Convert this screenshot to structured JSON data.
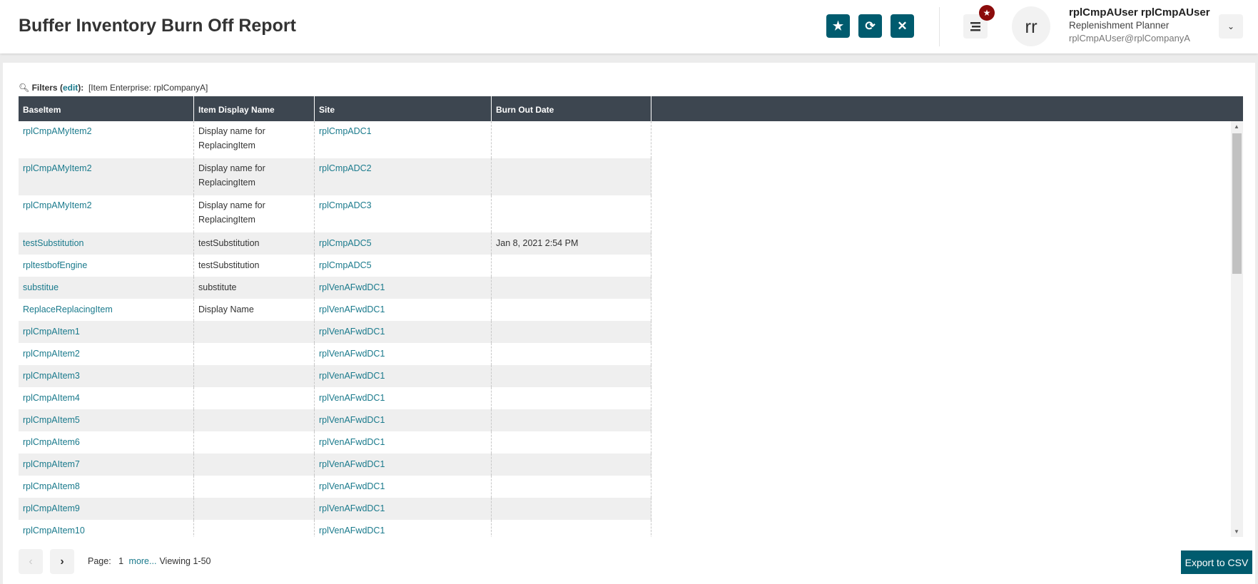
{
  "header": {
    "title": "Buffer Inventory Burn Off Report",
    "badge_icon": "star",
    "user_initials": "rr",
    "user_name": "rplCmpAUser rplCmpAUser",
    "user_role": "Replenishment Planner",
    "user_email": "rplCmpAUser@rplCompanyA"
  },
  "filters": {
    "label": "Filters",
    "edit": "edit",
    "value": "[Item Enterprise: rplCompanyA]"
  },
  "table": {
    "columns": [
      "BaseItem",
      "Item Display Name",
      "Site",
      "Burn Out Date",
      ""
    ],
    "rows": [
      [
        "rplCmpAMyItem2",
        "Display name for ReplacingItem",
        "rplCmpADC1",
        ""
      ],
      [
        "rplCmpAMyItem2",
        "Display name for ReplacingItem",
        "rplCmpADC2",
        ""
      ],
      [
        "rplCmpAMyItem2",
        "Display name for ReplacingItem",
        "rplCmpADC3",
        ""
      ],
      [
        "testSubstitution",
        "testSubstitution",
        "rplCmpADC5",
        "Jan 8, 2021 2:54 PM"
      ],
      [
        "rpltestbofEngine",
        "testSubstitution",
        "rplCmpADC5",
        ""
      ],
      [
        "substitue",
        "substitute",
        "rplVenAFwdDC1",
        ""
      ],
      [
        "ReplaceReplacingItem",
        "Display Name",
        "rplVenAFwdDC1",
        ""
      ],
      [
        "rplCmpAItem1",
        "",
        "rplVenAFwdDC1",
        ""
      ],
      [
        "rplCmpAItem2",
        "",
        "rplVenAFwdDC1",
        ""
      ],
      [
        "rplCmpAItem3",
        "",
        "rplVenAFwdDC1",
        ""
      ],
      [
        "rplCmpAItem4",
        "",
        "rplVenAFwdDC1",
        ""
      ],
      [
        "rplCmpAItem5",
        "",
        "rplVenAFwdDC1",
        ""
      ],
      [
        "rplCmpAItem6",
        "",
        "rplVenAFwdDC1",
        ""
      ],
      [
        "rplCmpAItem7",
        "",
        "rplVenAFwdDC1",
        ""
      ],
      [
        "rplCmpAItem8",
        "",
        "rplVenAFwdDC1",
        ""
      ],
      [
        "rplCmpAItem9",
        "",
        "rplVenAFwdDC1",
        ""
      ],
      [
        "rplCmpAItem10",
        "",
        "rplVenAFwdDC1",
        ""
      ]
    ]
  },
  "pager": {
    "page_label": "Page:",
    "page": "1",
    "more": "more...",
    "viewing": "Viewing 1-50"
  },
  "export_label": "Export to CSV",
  "colors": {
    "accent": "#005b6e",
    "link": "#1a7a8c",
    "header_bg": "#3d4650"
  }
}
